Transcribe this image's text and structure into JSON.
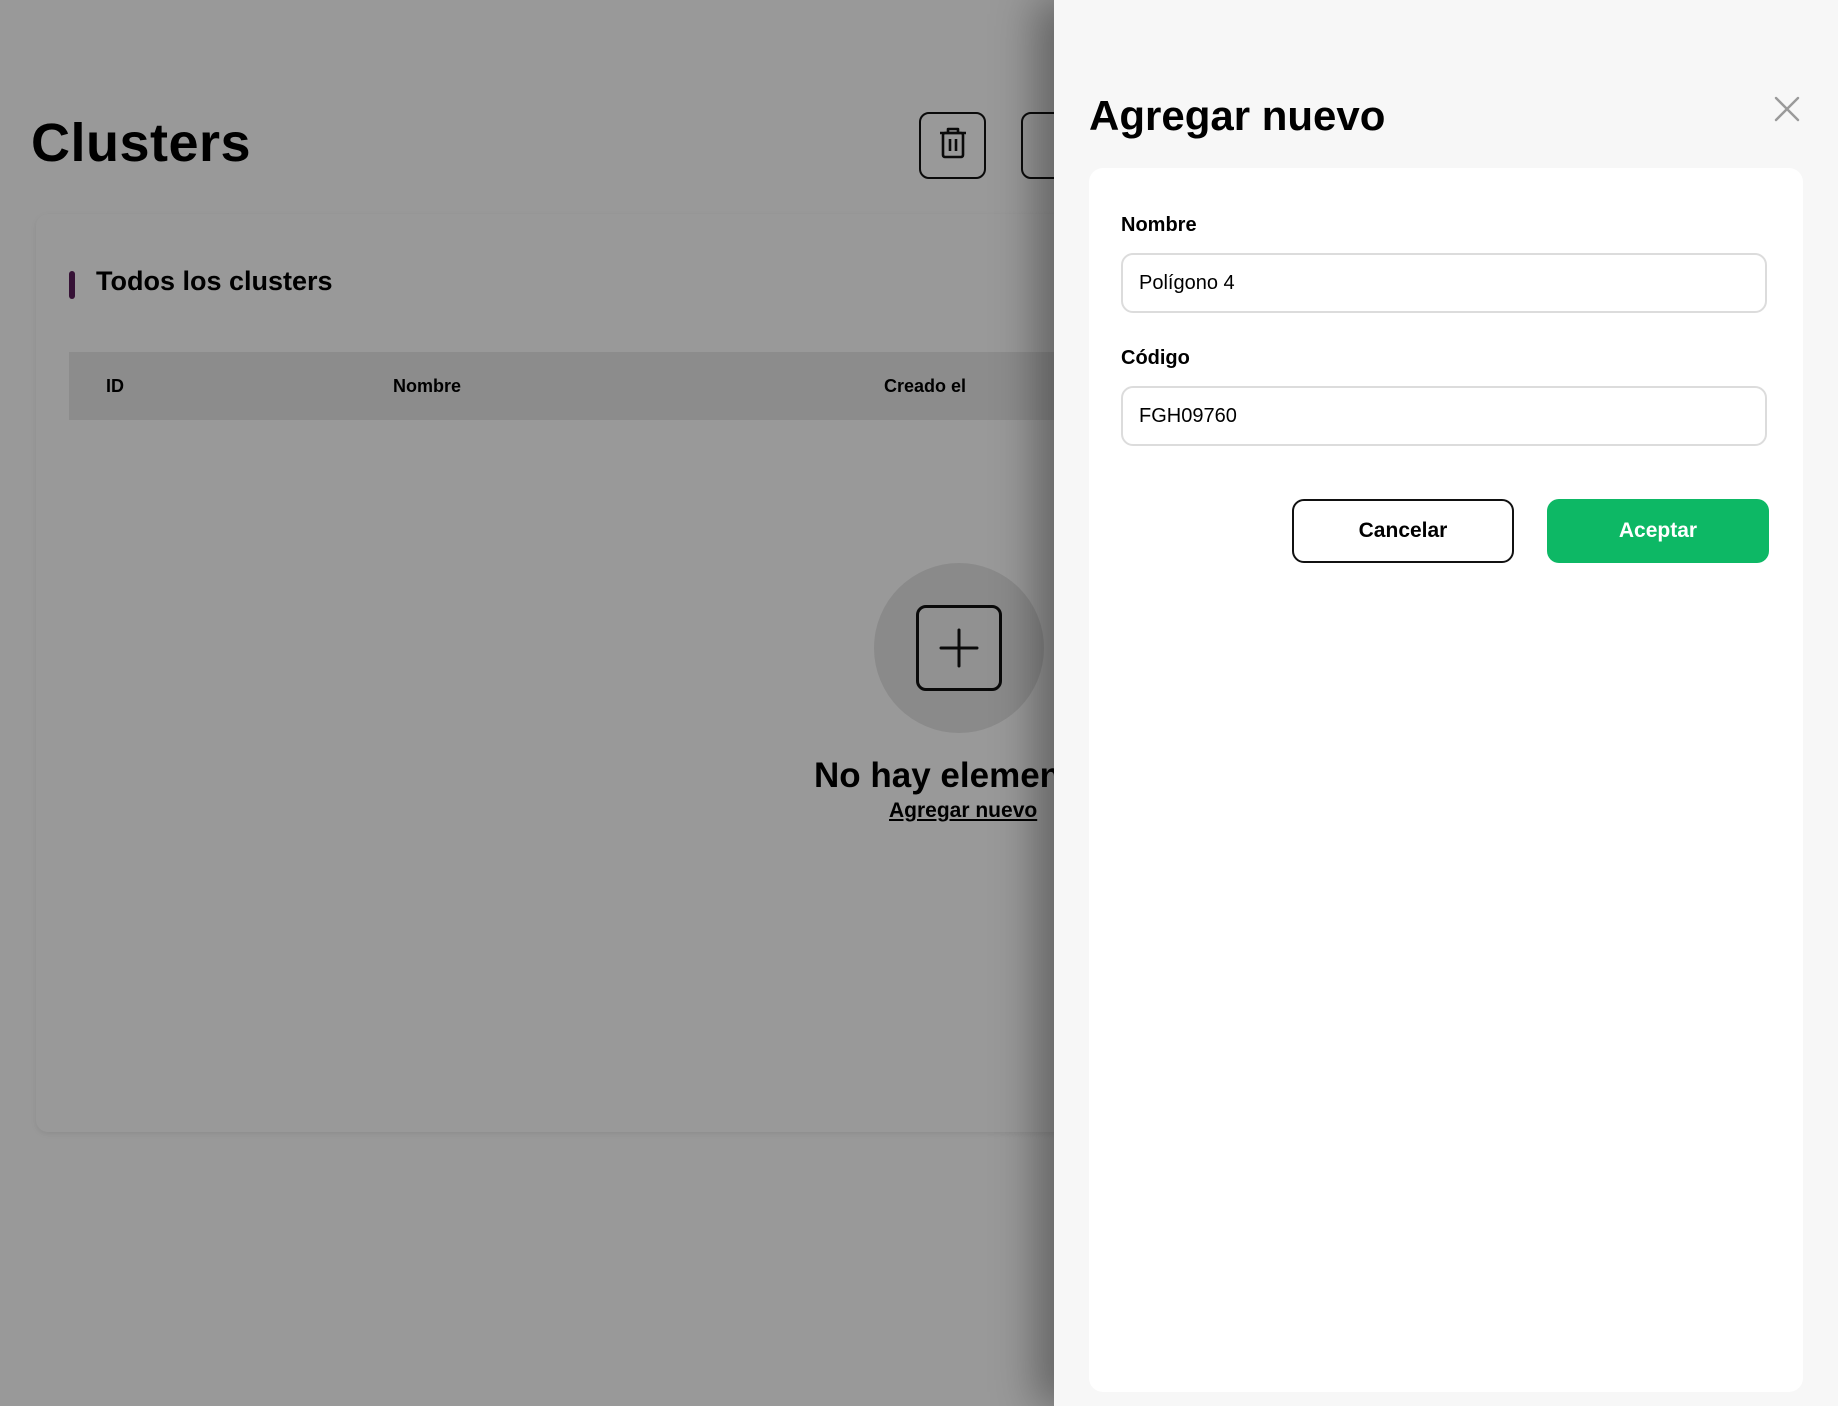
{
  "page": {
    "title": "Clusters",
    "card": {
      "title": "Todos los clusters",
      "accent_color": "#5a1e5a",
      "table": {
        "columns": [
          "ID",
          "Nombre",
          "Creado el"
        ]
      },
      "empty_state": {
        "title": "No hay elementos",
        "link": "Agregar nuevo",
        "icon": "plus-square-icon"
      }
    },
    "toolbar": {
      "delete_icon": "trash-icon"
    }
  },
  "drawer": {
    "title": "Agregar nuevo",
    "close_icon": "close-icon",
    "fields": {
      "nombre": {
        "label": "Nombre",
        "value": "Polígono 4"
      },
      "codigo": {
        "label": "Código",
        "value": "FGH09760"
      }
    },
    "buttons": {
      "cancel": "Cancelar",
      "accept": "Aceptar",
      "accept_color": "#0db865"
    }
  }
}
